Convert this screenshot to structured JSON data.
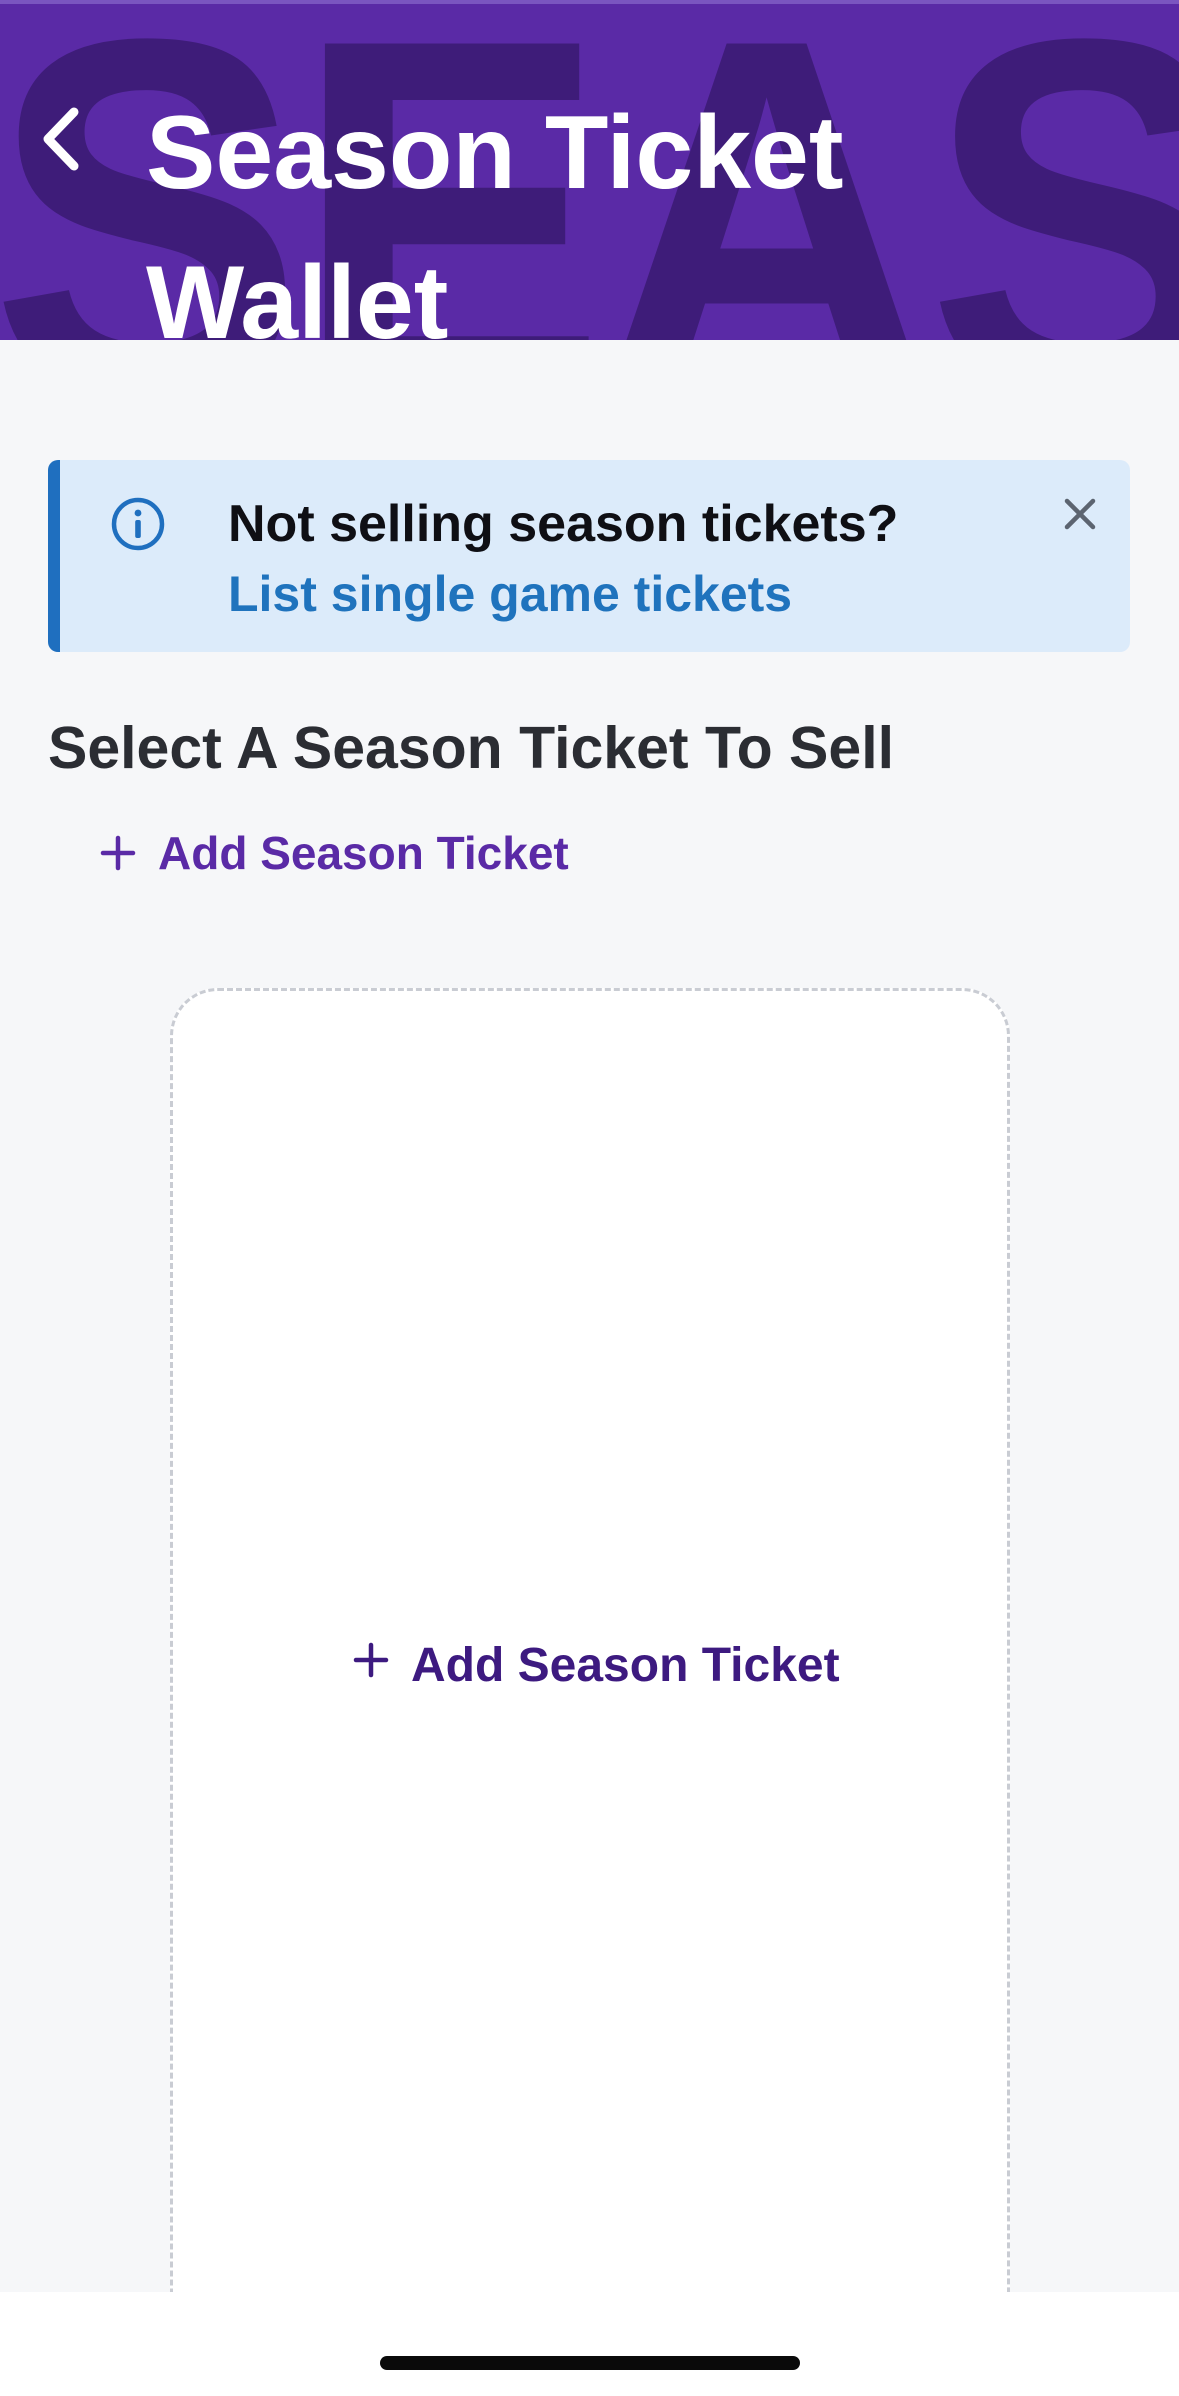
{
  "header": {
    "title": "Season Ticket Wallet",
    "watermark_text": "SEASON T",
    "background_color": "#5a2aa6",
    "back_icon": "chevron-left-icon"
  },
  "banner": {
    "heading": "Not selling season tickets?",
    "link_label": "List single game tickets",
    "info_icon": "info-icon",
    "close_icon": "close-icon",
    "accent_color": "#1f6fbf"
  },
  "section": {
    "title": "Select A Season Ticket To Sell",
    "add_label": "Add Season Ticket"
  },
  "card": {
    "add_label": "Add Season Ticket"
  }
}
